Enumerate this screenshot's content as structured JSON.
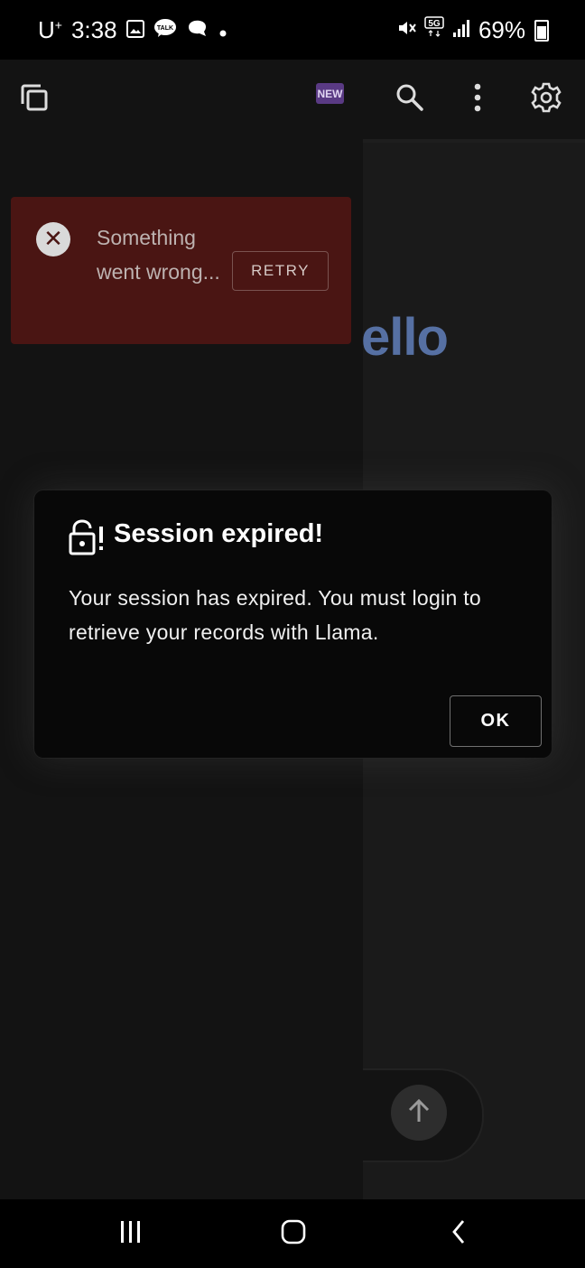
{
  "status_bar": {
    "carrier": "U",
    "carrier_sup": "+",
    "time": "3:38",
    "battery": "69%",
    "network": "5G"
  },
  "app_bar": {
    "new_badge": "NEW"
  },
  "background": {
    "greeting_partial": "ello"
  },
  "error_toast": {
    "message": "Something went wrong...",
    "retry_label": "RETRY"
  },
  "dialog": {
    "title": "Session expired!",
    "body": "Your session has expired. You must login to retrieve your records with Llama.",
    "ok_label": "OK"
  },
  "colors": {
    "background": "#131313",
    "error_toast_bg": "#4a1513",
    "greeting_text": "#5670a3",
    "new_badge_bg": "#5a3a84",
    "dialog_bg": "#080808"
  }
}
